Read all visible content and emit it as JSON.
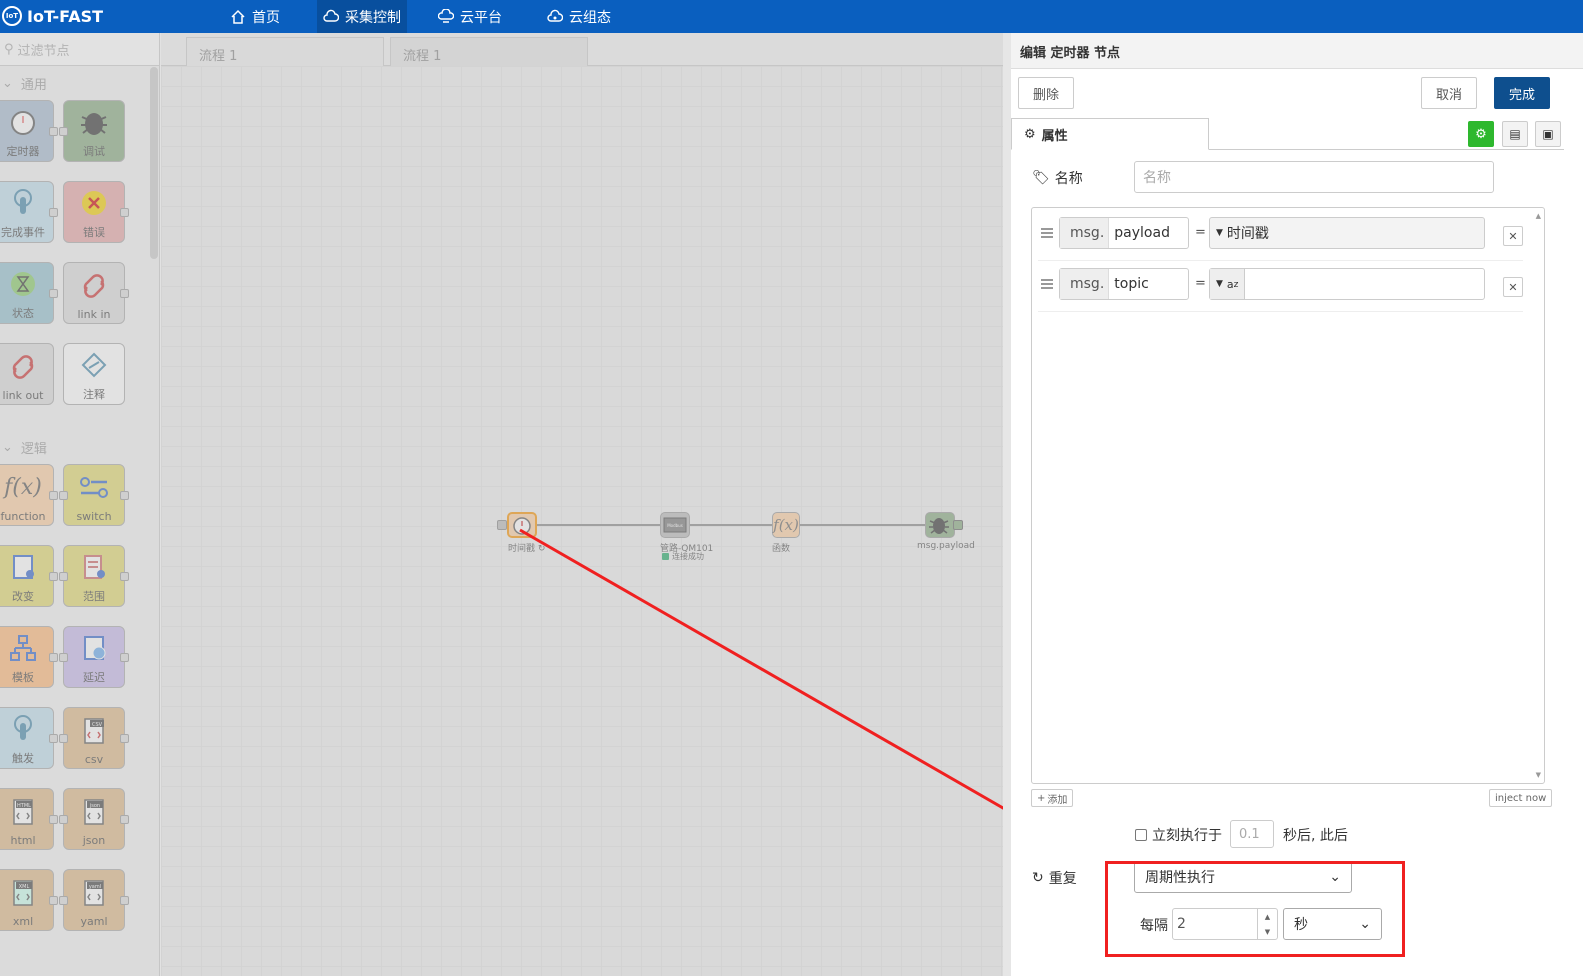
{
  "app": {
    "title": "IoT-FAST",
    "logo_text": "IoT"
  },
  "nav": [
    {
      "label": "首页",
      "icon": "home-icon"
    },
    {
      "label": "采集控制",
      "icon": "cloud-settings-icon",
      "active": true
    },
    {
      "label": "云平台",
      "icon": "cloud-platform-icon"
    },
    {
      "label": "云组态",
      "icon": "cloud-config-icon"
    }
  ],
  "palette": {
    "filter_placeholder": "过滤节点",
    "categories": {
      "common": "通用",
      "logic": "逻辑"
    },
    "nodes": {
      "timer": "定时器",
      "debug": "调试",
      "complete": "完成事件",
      "error": "错误",
      "status": "状态",
      "link_in": "link in",
      "link_out": "link out",
      "comment": "注释",
      "function": "function",
      "switch": "switch",
      "change": "改变",
      "range": "范围",
      "template": "模板",
      "delay": "延迟",
      "trigger": "触发",
      "csv": "csv",
      "html": "html",
      "json": "json",
      "xml": "xml",
      "yaml": "yaml"
    },
    "icon_text": {
      "html": "HTML",
      "json": "json",
      "xml": "XML",
      "yaml": "yaml",
      "csv": "CSV",
      "modbus": "Modbus"
    }
  },
  "tabs": [
    "流程 1",
    "流程 1"
  ],
  "flow": {
    "nodes": [
      {
        "label": "时间戳 ↻"
      },
      {
        "label": "管路-QM101",
        "status": "连接成功"
      },
      {
        "label": "函数"
      },
      {
        "label": "msg.payload"
      }
    ]
  },
  "editor": {
    "title": "编辑 定时器 节点",
    "delete_label": "删除",
    "cancel_label": "取消",
    "done_label": "完成",
    "properties_tab": "属性",
    "name_label": "名称",
    "name_placeholder": "名称",
    "rows": [
      {
        "prefix": "msg.",
        "key": "payload",
        "eq": "=",
        "value": "时间戳"
      },
      {
        "prefix": "msg.",
        "key": "topic",
        "eq": "=",
        "value": "",
        "type_glyph": "a",
        "type_sub": "z"
      }
    ],
    "add_label": "添加",
    "inject_now_label": "inject now",
    "once_label": "立刻执行于",
    "once_value": "0.1",
    "once_suffix": "秒后, 此后",
    "repeat_label": "重复",
    "repeat_mode": "周期性执行",
    "every_label": "每隔",
    "every_value": "2",
    "unit": "秒"
  },
  "colors": {
    "header": "#0a5fbf",
    "primary_button": "#0e4f8e",
    "annotation": "#f02020",
    "green_button": "#2eb82e"
  }
}
